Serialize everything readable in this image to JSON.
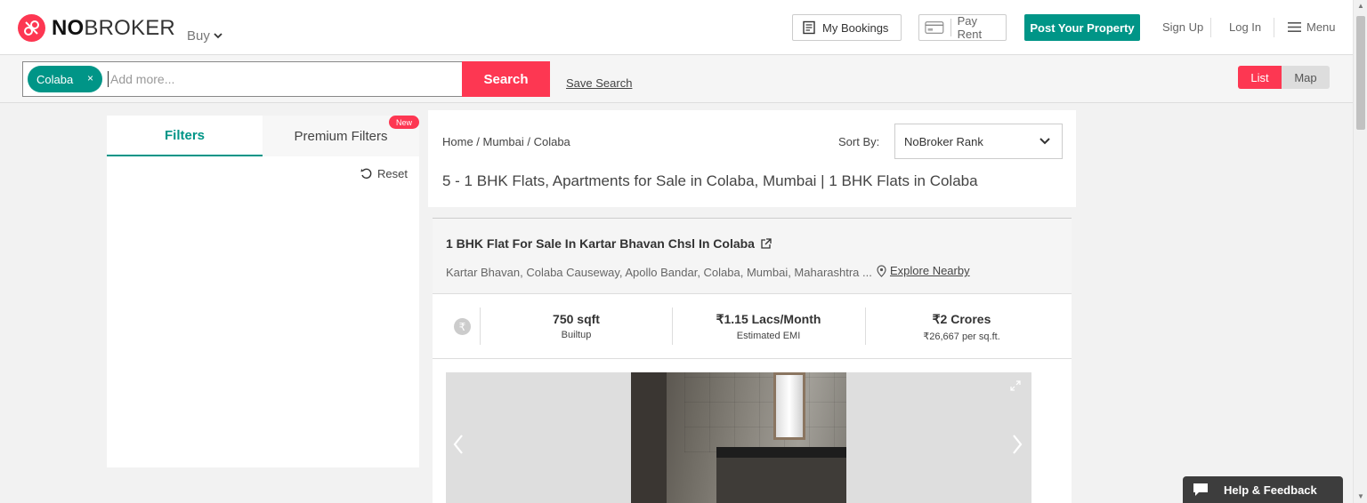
{
  "header": {
    "logo_bold": "NO",
    "logo_light": "BROKER",
    "buy_label": "Buy",
    "my_bookings": "My Bookings",
    "pay_rent": "Pay Rent",
    "post_property": "Post Your Property",
    "sign_up": "Sign Up",
    "log_in": "Log In",
    "menu": "Menu"
  },
  "search": {
    "chip_label": "Colaba",
    "chip_close": "×",
    "placeholder": "Add more...",
    "button": "Search",
    "save_search": "Save Search"
  },
  "view_toggle": {
    "list": "List",
    "map": "Map",
    "active": "List"
  },
  "filters": {
    "tab_filters": "Filters",
    "tab_premium": "Premium Filters",
    "new_badge": "New",
    "reset": "Reset"
  },
  "results": {
    "breadcrumb": "Home  / Mumbai / Colaba",
    "sort_label": "Sort By:",
    "sort_value": "NoBroker Rank",
    "title": "5 - 1 BHK Flats, Apartments for Sale in Colaba, Mumbai | 1 BHK Flats in Colaba"
  },
  "listing": {
    "title": "1 BHK Flat For Sale In Kartar Bhavan Chsl In Colaba",
    "address": "Kartar Bhavan, Colaba Causeway, Apollo Bandar, Colaba, Mumbai, Maharashtra ...",
    "explore": "Explore Nearby",
    "rupee_symbol": "₹",
    "stats": [
      {
        "value": "750 sqft",
        "label": "Builtup"
      },
      {
        "value": "₹1.15 Lacs/Month",
        "label": "Estimated EMI"
      },
      {
        "value": "₹2 Crores",
        "label": "₹26,667 per sq.ft."
      }
    ]
  },
  "help": {
    "label": "Help & Feedback"
  },
  "colors": {
    "brand_red": "#fd3752",
    "brand_teal": "#009587"
  }
}
